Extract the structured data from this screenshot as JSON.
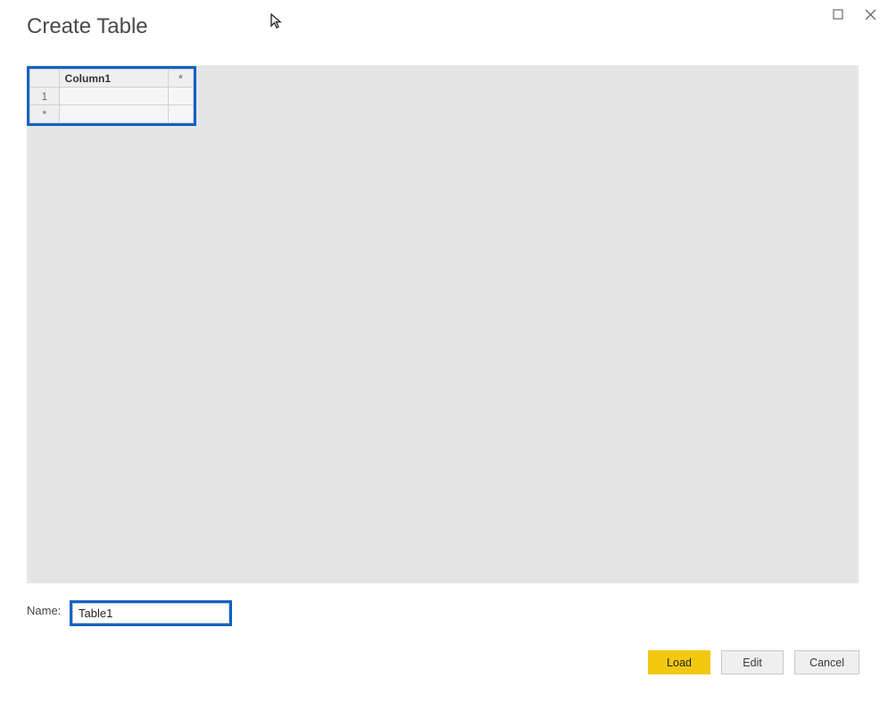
{
  "dialog": {
    "title": "Create Table",
    "name_label": "Name:",
    "name_value": "Table1"
  },
  "grid": {
    "columns": [
      "Column1"
    ],
    "add_column_marker": "*",
    "row_headers": [
      "1",
      "*"
    ],
    "cells": [
      [
        ""
      ],
      [
        ""
      ]
    ]
  },
  "buttons": {
    "load": "Load",
    "edit": "Edit",
    "cancel": "Cancel"
  }
}
